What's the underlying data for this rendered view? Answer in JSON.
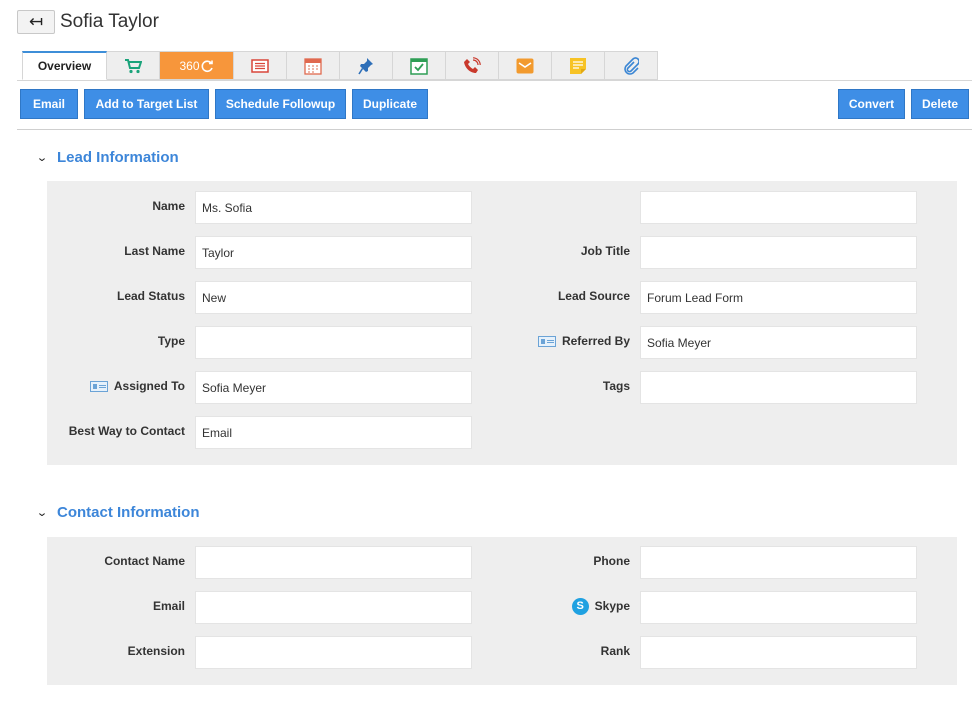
{
  "header": {
    "back_icon": "back-arrow-icon",
    "title": "Sofia Taylor"
  },
  "tabs": [
    {
      "label": "Overview",
      "icon": ""
    },
    {
      "label": "",
      "icon": "cart-icon"
    },
    {
      "label": "360",
      "icon": "refresh-icon"
    },
    {
      "label": "",
      "icon": "list-icon"
    },
    {
      "label": "",
      "icon": "calendar-icon"
    },
    {
      "label": "",
      "icon": "pin-icon"
    },
    {
      "label": "",
      "icon": "task-check-icon"
    },
    {
      "label": "",
      "icon": "phone-call-icon"
    },
    {
      "label": "",
      "icon": "mail-icon"
    },
    {
      "label": "",
      "icon": "note-icon"
    },
    {
      "label": "",
      "icon": "paperclip-icon"
    }
  ],
  "actions": {
    "email": "Email",
    "add_to_target_list": "Add to Target List",
    "schedule_followup": "Schedule Followup",
    "duplicate": "Duplicate",
    "convert": "Convert",
    "delete": "Delete"
  },
  "lead_info": {
    "title": "Lead Information",
    "name_label": "Name",
    "name_value": "Ms. Sofia",
    "unnamed_value": "",
    "last_name_label": "Last Name",
    "last_name_value": "Taylor",
    "job_title_label": "Job Title",
    "job_title_value": "",
    "lead_status_label": "Lead Status",
    "lead_status_value": "New",
    "lead_source_label": "Lead Source",
    "lead_source_value": "Forum Lead Form",
    "type_label": "Type",
    "type_value": "",
    "referred_by_label": "Referred By",
    "referred_by_value": "Sofia Meyer",
    "assigned_to_label": "Assigned To",
    "assigned_to_value": "Sofia Meyer",
    "tags_label": "Tags",
    "tags_value": "",
    "best_way_label": "Best Way to Contact",
    "best_way_value": "Email"
  },
  "contact_info": {
    "title": "Contact Information",
    "contact_name_label": "Contact Name",
    "contact_name_value": "",
    "phone_label": "Phone",
    "phone_value": "",
    "email_label": "Email",
    "email_value": "",
    "skype_label": "Skype",
    "skype_value": "",
    "extension_label": "Extension",
    "extension_value": "",
    "rank_label": "Rank",
    "rank_value": ""
  },
  "colors": {
    "accent": "#3e8ee6",
    "tab_360": "#f7963b",
    "section_title": "#3d86d9",
    "panel_bg": "#eeeeee"
  }
}
